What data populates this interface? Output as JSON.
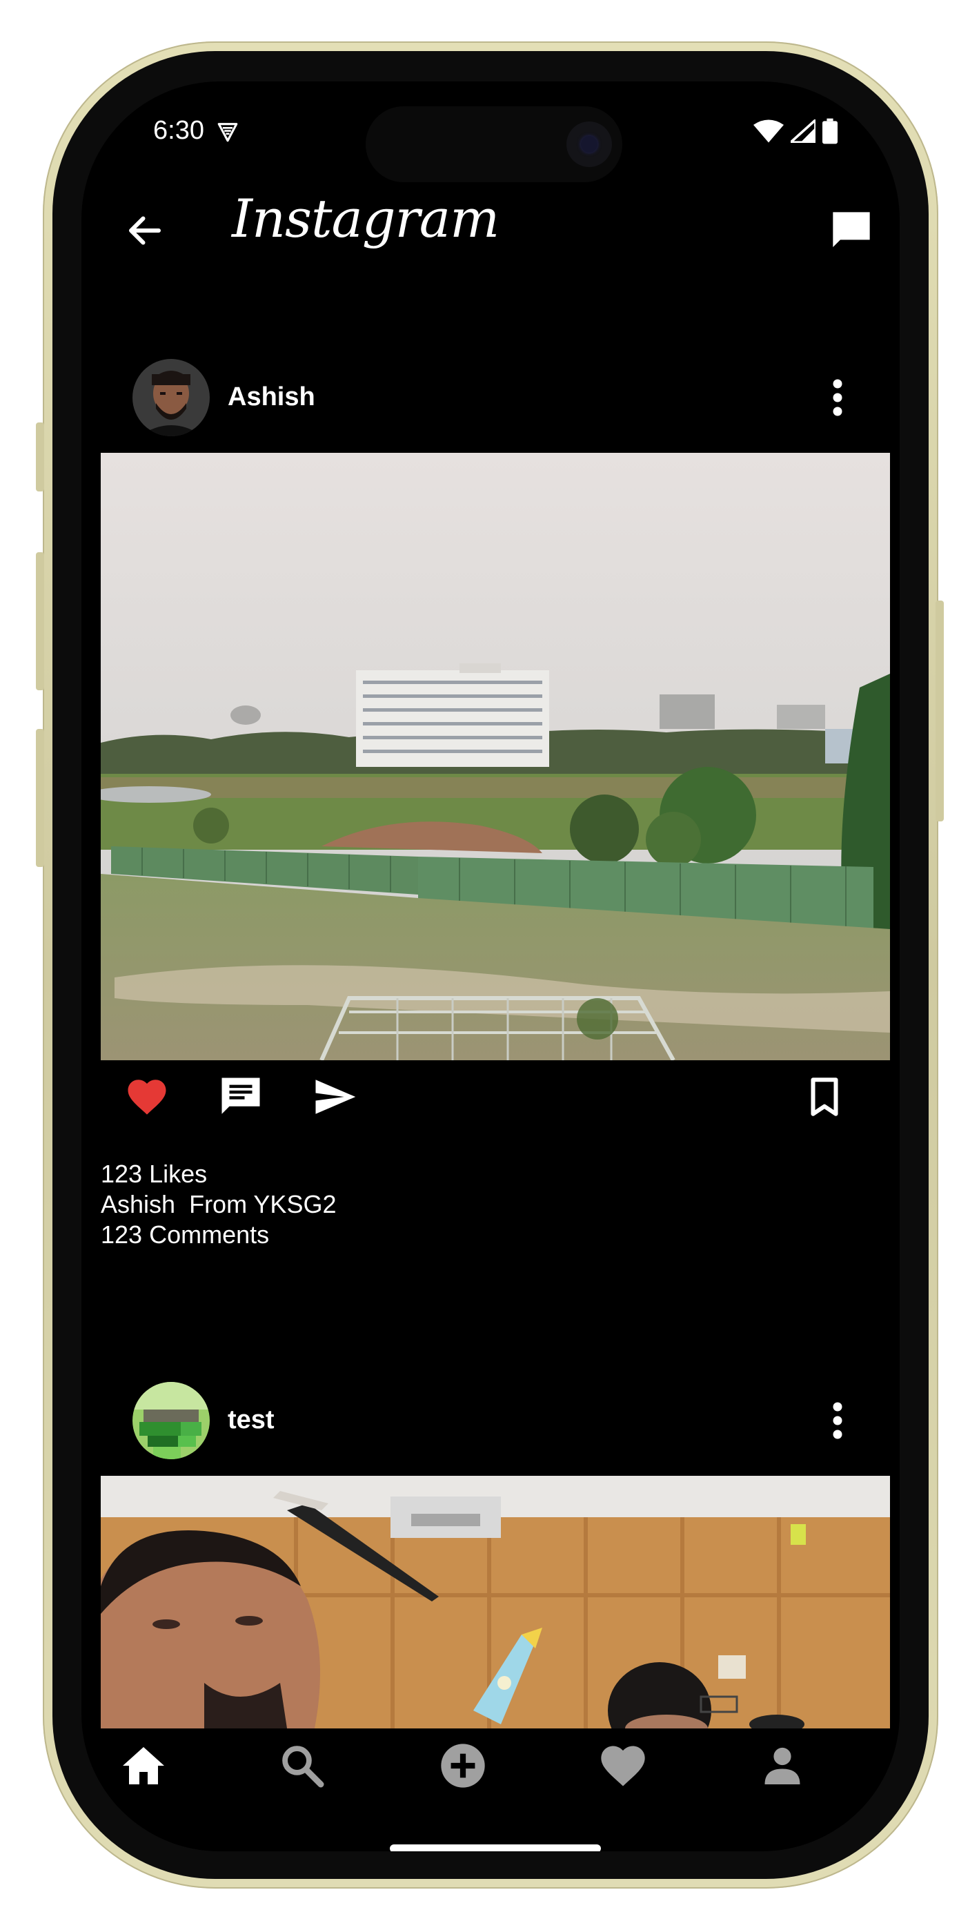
{
  "status_bar": {
    "time": "6:30"
  },
  "app_bar": {
    "title": "Instagram"
  },
  "posts": [
    {
      "username": "Ashish",
      "likes": "123 Likes",
      "caption_user": "Ashish",
      "caption_text": "From YKSG2",
      "comments": "123 Comments",
      "liked": true
    },
    {
      "username": "test"
    }
  ],
  "bottom_nav": {
    "items": [
      "home",
      "search",
      "add",
      "activity",
      "profile"
    ],
    "active": "home"
  },
  "colors": {
    "background": "#000000",
    "like": "#e53935",
    "text": "#ffffff"
  }
}
